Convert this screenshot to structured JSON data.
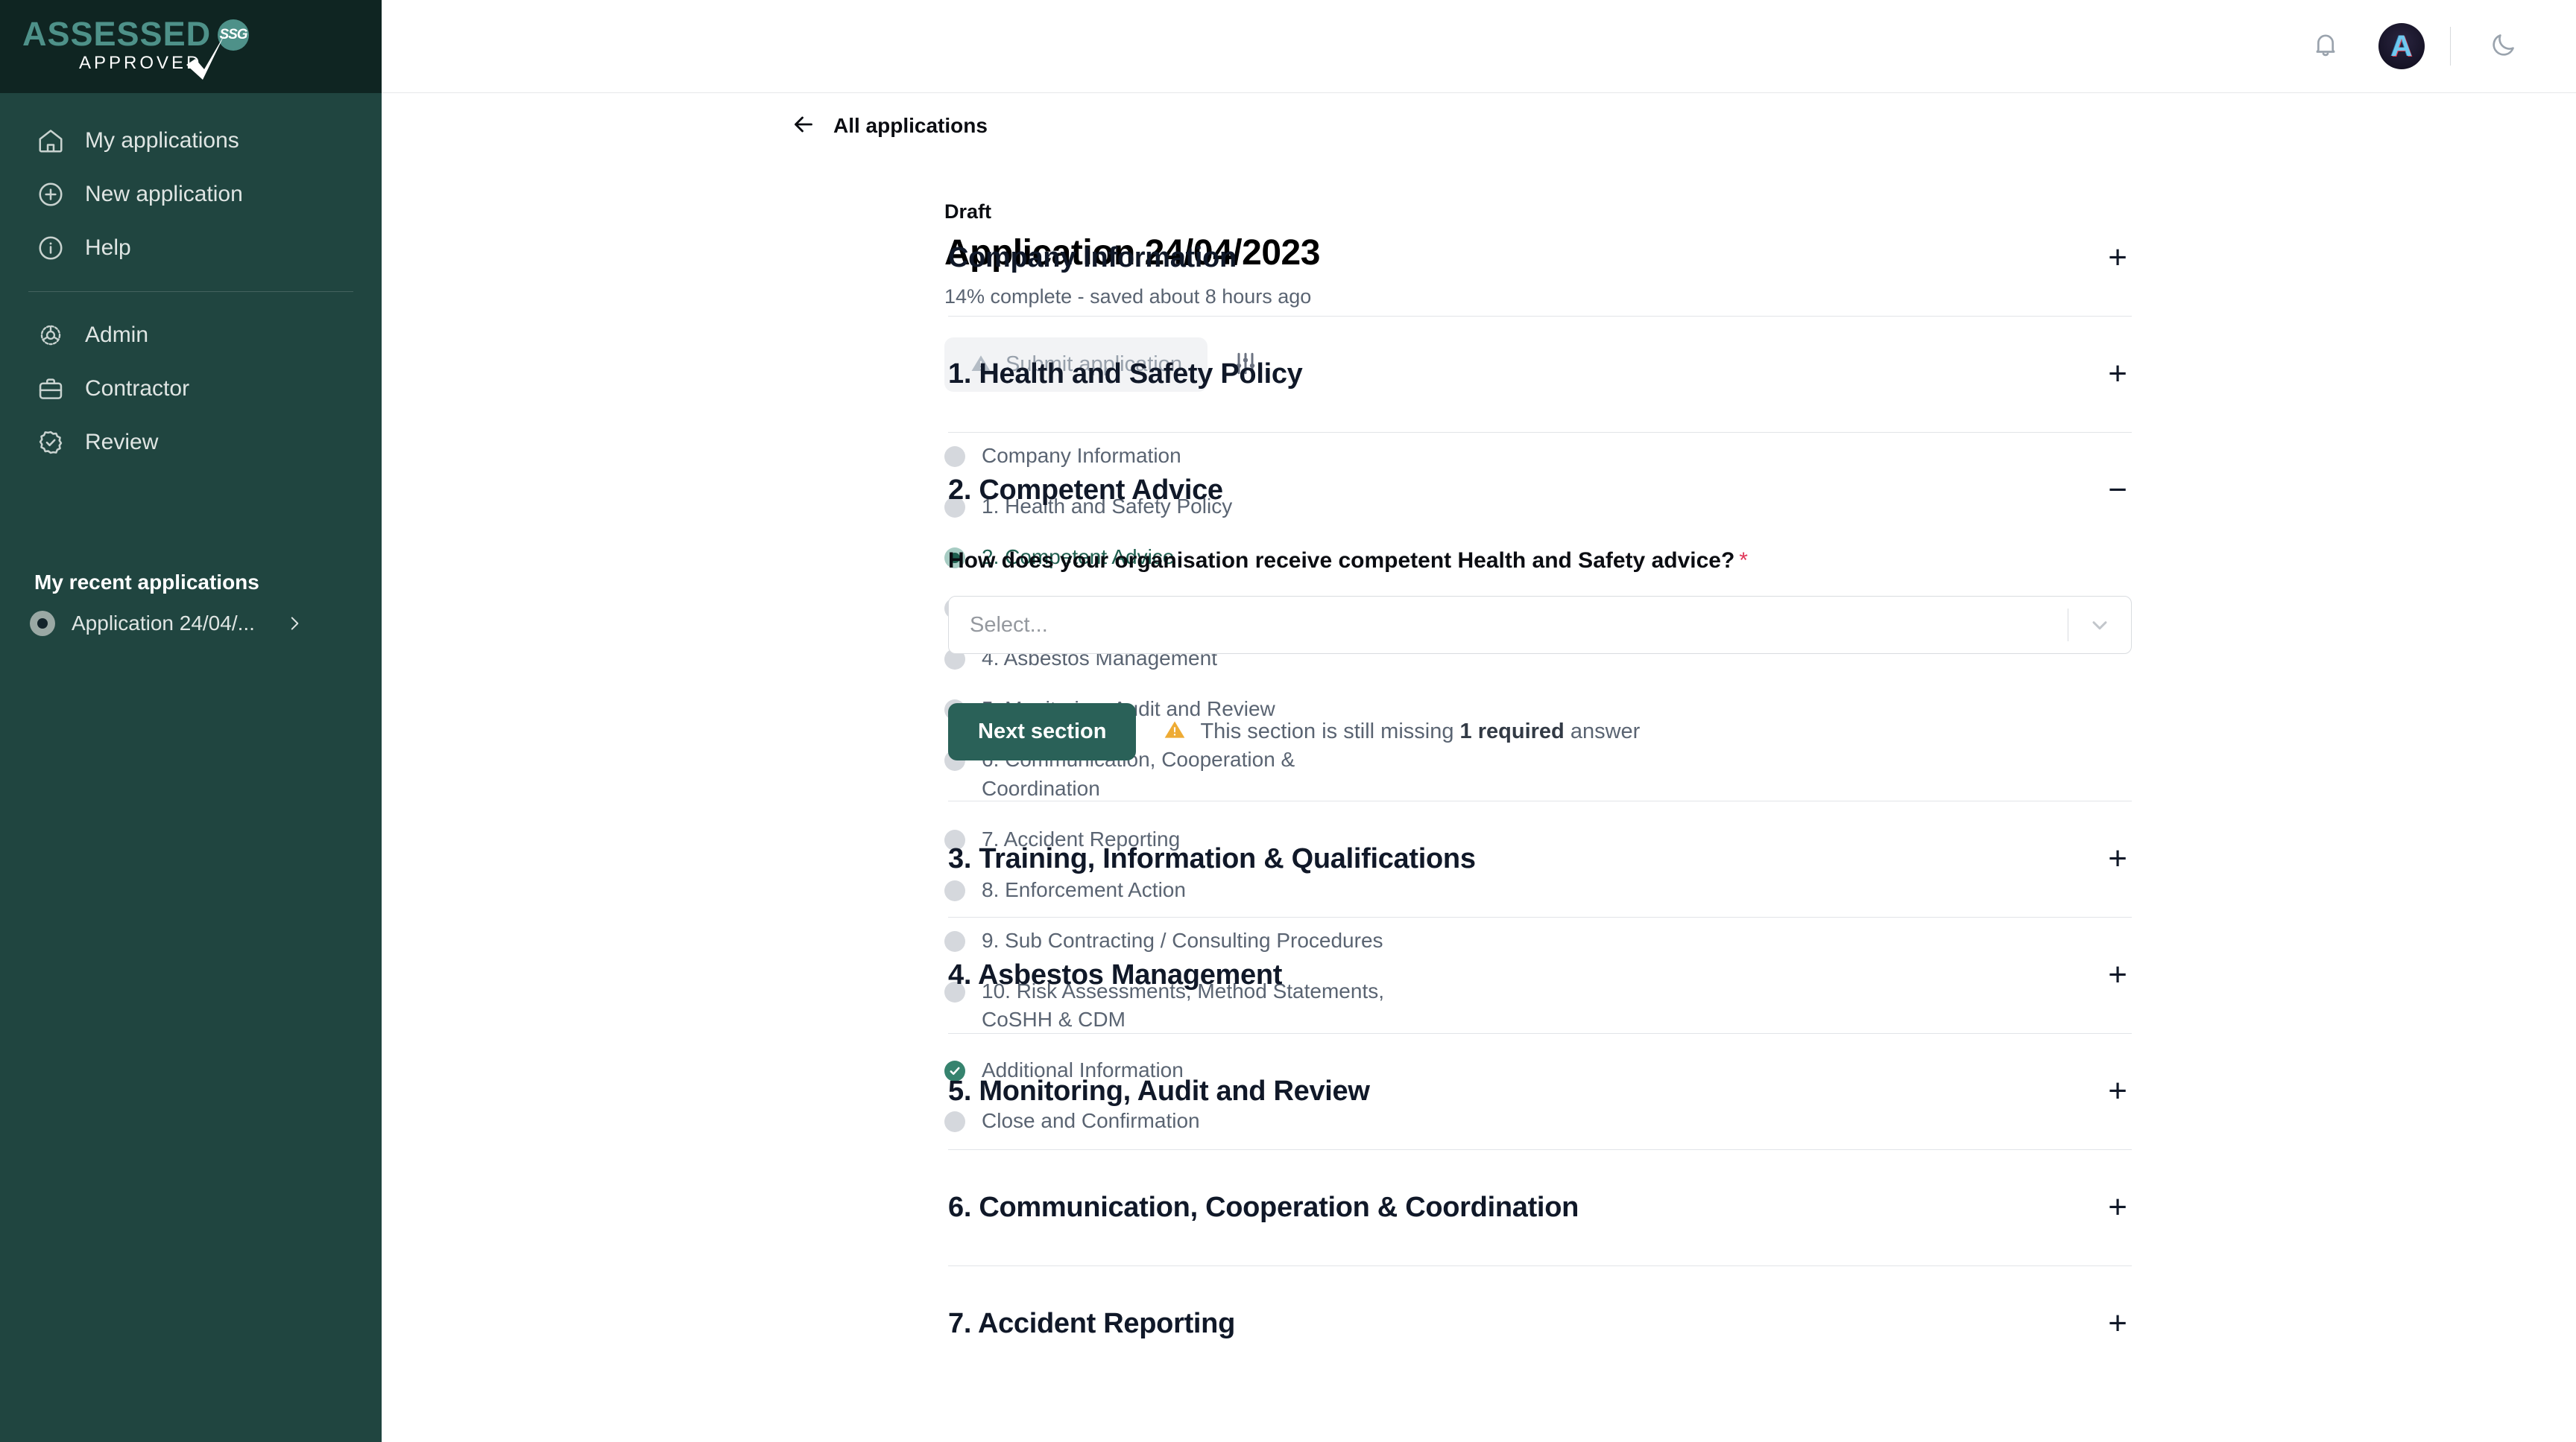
{
  "brand": {
    "logo_primary": "ASSESSED",
    "logo_badge": "SSG",
    "logo_secondary": "APPROVED",
    "accent_green": "#4e9189",
    "sidebar_bg": "#204540",
    "sidebar_header_bg": "#0f2522",
    "primary_button": "#2a6158",
    "required_red": "#e0385a",
    "warning_amber": "#eeab34",
    "active_green": "#1f5f4f",
    "complete_green": "#36836e"
  },
  "sidebar": {
    "items": [
      {
        "label": "My applications",
        "icon": "home-icon"
      },
      {
        "label": "New application",
        "icon": "plus-circle-icon"
      },
      {
        "label": "Help",
        "icon": "info-circle-icon"
      },
      {
        "label": "Admin",
        "icon": "gear-icon"
      },
      {
        "label": "Contractor",
        "icon": "briefcase-icon"
      },
      {
        "label": "Review",
        "icon": "badge-check-icon"
      }
    ],
    "recent_title": "My recent applications",
    "recent": [
      {
        "label": "Application 24/04/...",
        "icon": "chevron-right-icon"
      }
    ]
  },
  "topbar": {
    "notifications_icon": "bell-icon",
    "avatar_initial": "A",
    "theme_toggle_icon": "moon-icon"
  },
  "breadcrumb": {
    "back_icon": "arrow-left-icon",
    "label": "All applications"
  },
  "application": {
    "status": "Draft",
    "title": "Application 24/04/2023",
    "progress_text": "14% complete - saved about 8 hours ago",
    "progress_percent": 14,
    "submit_label": "Submit application",
    "submit_icon": "warning-triangle-icon",
    "settings_icon": "sliders-icon",
    "sections": [
      {
        "label": "Company Information",
        "state": "pending"
      },
      {
        "label": "1. Health and Safety Policy",
        "state": "pending"
      },
      {
        "label": "2. Competent Advice",
        "state": "active"
      },
      {
        "label": "3. Training, Information & Qualifications",
        "state": "pending"
      },
      {
        "label": "4. Asbestos Management",
        "state": "pending"
      },
      {
        "label": "5. Monitoring, Audit and Review",
        "state": "pending"
      },
      {
        "label": "6. Communication, Cooperation & Coordination",
        "state": "pending"
      },
      {
        "label": "7. Accident Reporting",
        "state": "pending"
      },
      {
        "label": "8. Enforcement Action",
        "state": "pending"
      },
      {
        "label": "9. Sub Contracting / Consulting Procedures",
        "state": "pending"
      },
      {
        "label": "10. Risk Assessments, Method Statements, CoSHH & CDM",
        "state": "pending"
      },
      {
        "label": "Additional Information",
        "state": "complete"
      },
      {
        "label": "Close and Confirmation",
        "state": "pending"
      }
    ]
  },
  "accordion": {
    "expand_sign": "+",
    "collapse_sign": "−",
    "panels": [
      {
        "title": "Company Information",
        "expanded": false
      },
      {
        "title": "1. Health and Safety Policy",
        "expanded": false
      },
      {
        "title": "2. Competent Advice",
        "expanded": true
      },
      {
        "title": "3. Training, Information & Qualifications",
        "expanded": false
      },
      {
        "title": "4. Asbestos Management",
        "expanded": false
      },
      {
        "title": "5. Monitoring, Audit and Review",
        "expanded": false
      },
      {
        "title": "6. Communication, Cooperation & Coordination",
        "expanded": false
      },
      {
        "title": "7. Accident Reporting",
        "expanded": false
      }
    ]
  },
  "competent_advice": {
    "question": "How does your organisation receive competent Health and Safety advice?",
    "required_marker": "*",
    "select_placeholder": "Select...",
    "select_value": "",
    "select_chevron_icon": "chevron-down-icon",
    "next_label": "Next section",
    "warning_icon": "warning-triangle-icon",
    "missing_prefix": "This section is still missing ",
    "missing_count": "1 required",
    "missing_suffix": " answer"
  }
}
